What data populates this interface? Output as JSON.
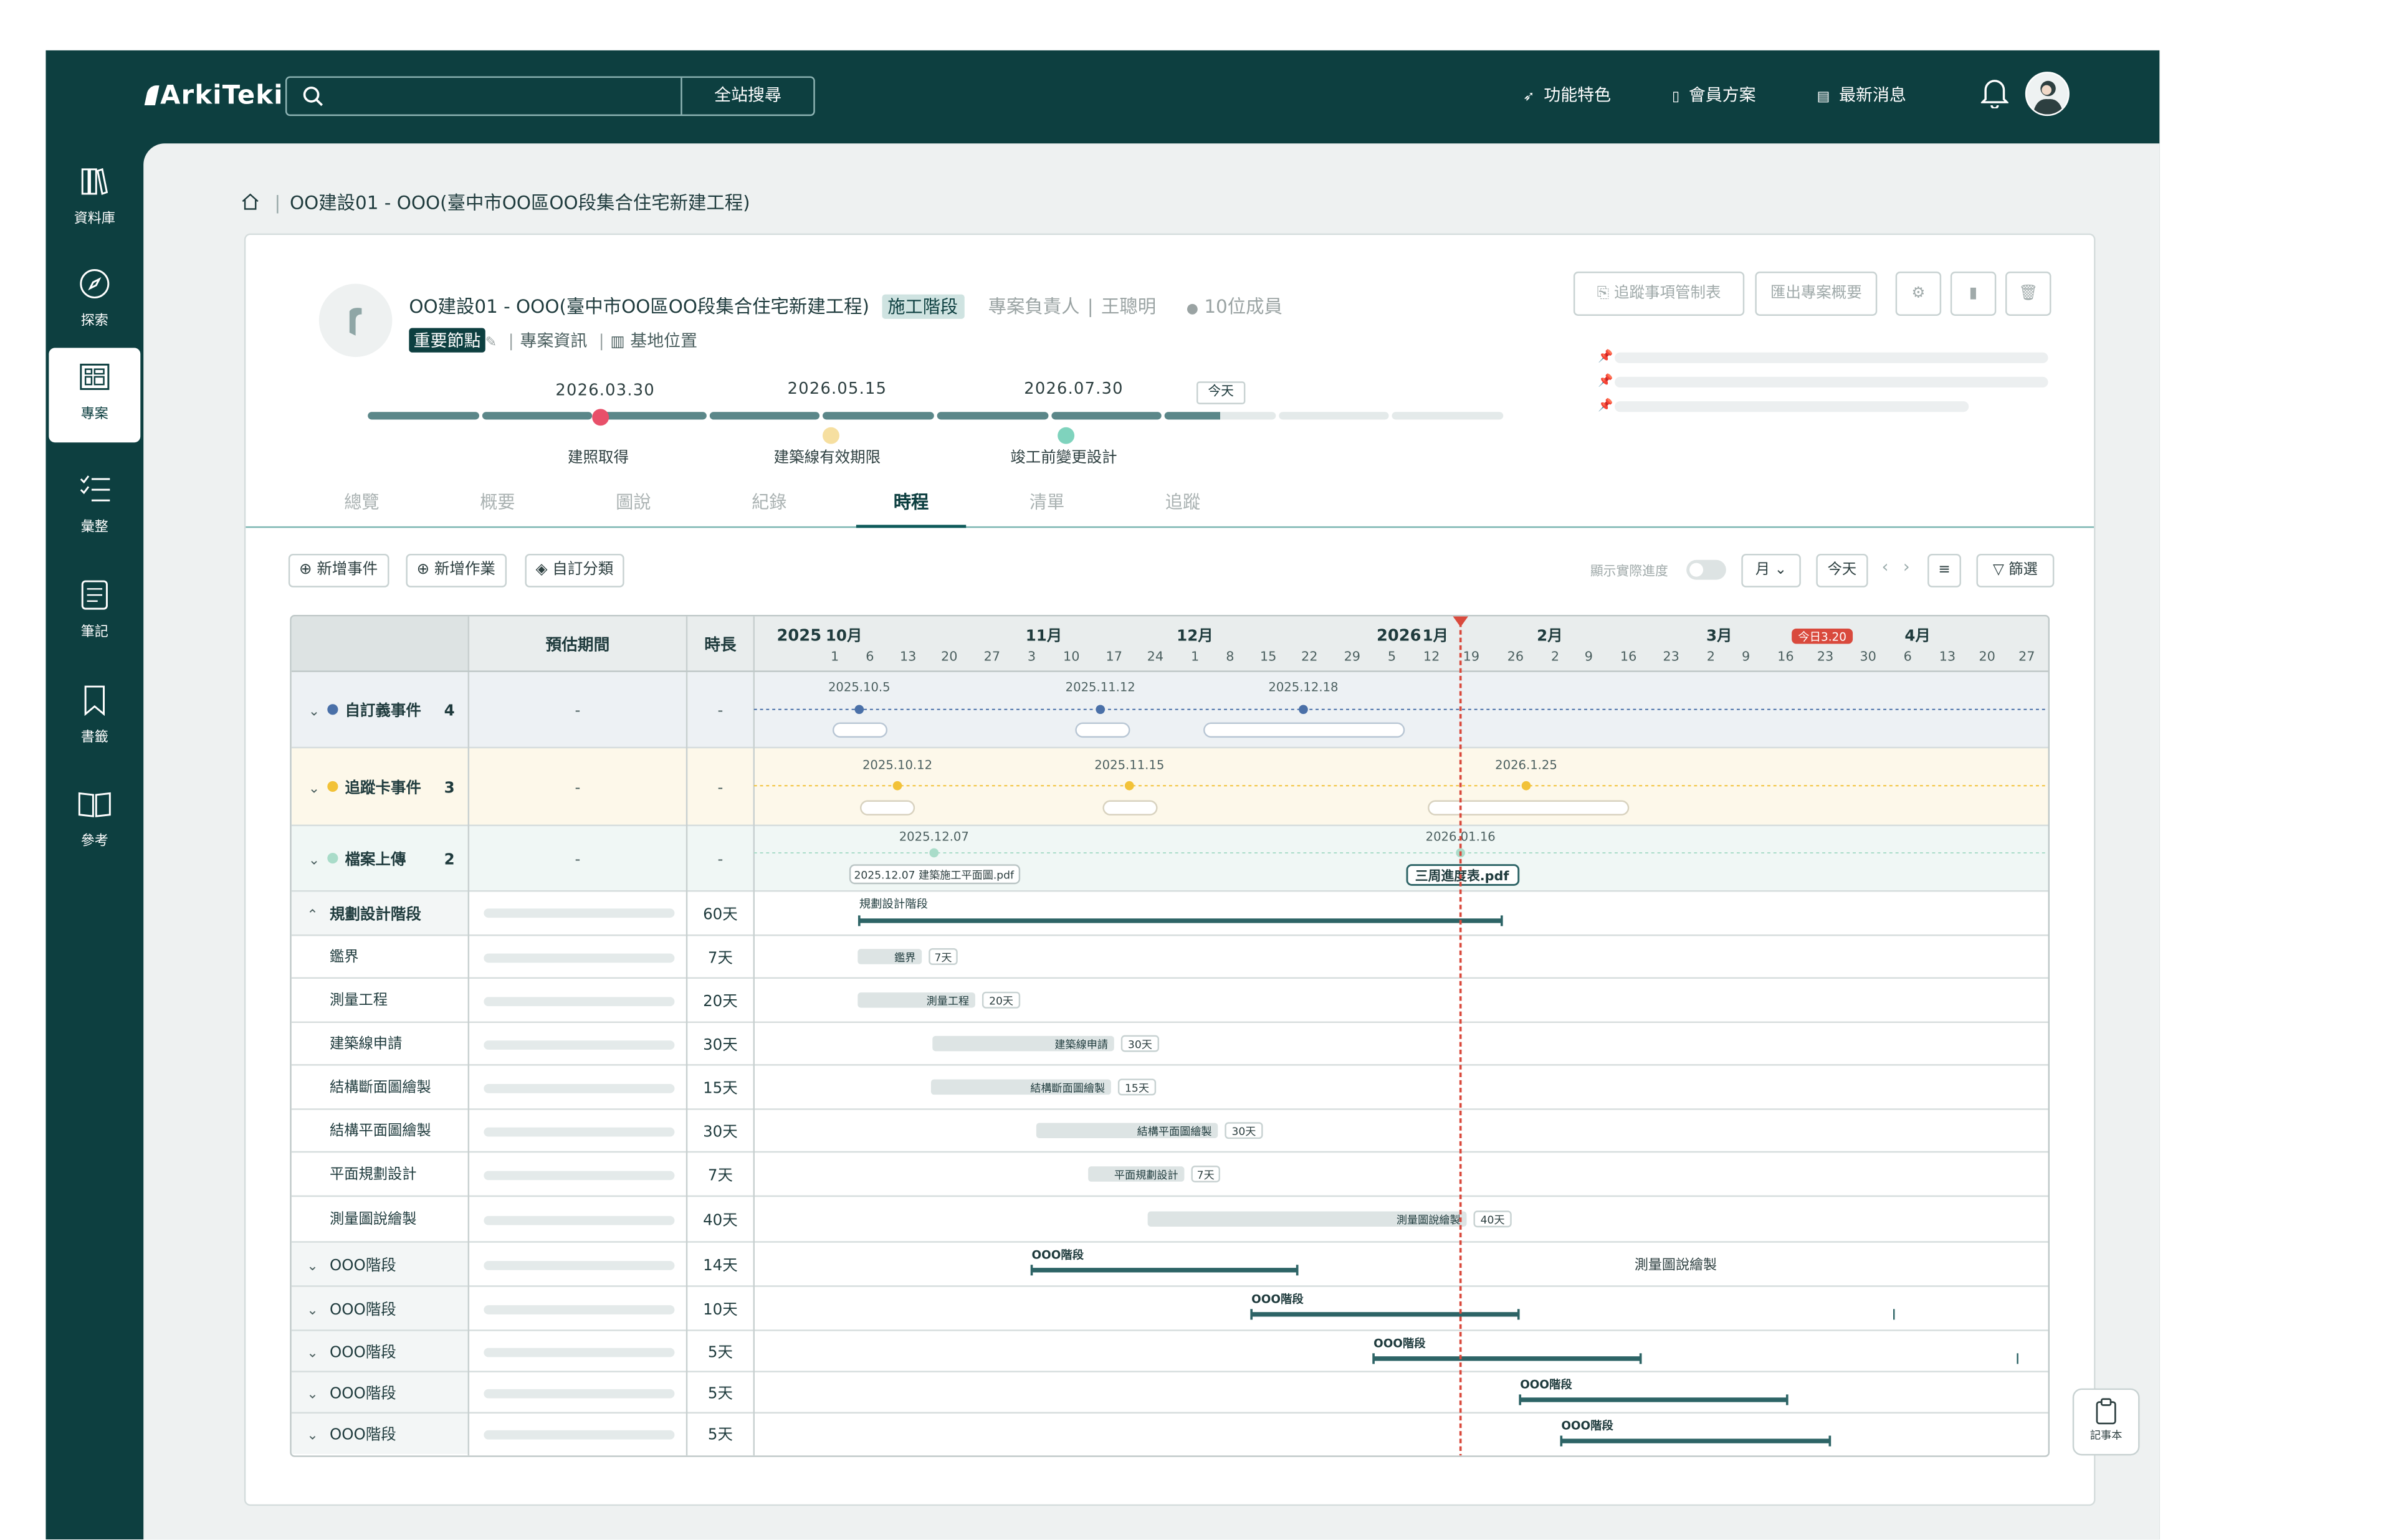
{
  "app": {
    "logo": "ArkiTeki"
  },
  "topbar": {
    "search_placeholder": "",
    "search_button": "全站搜尋",
    "nav": [
      "功能特色",
      "會員方案",
      "最新消息"
    ]
  },
  "sidebar": {
    "items": [
      {
        "label": "資料庫",
        "icon": "books-icon"
      },
      {
        "label": "探索",
        "icon": "compass-icon"
      },
      {
        "label": "專案",
        "icon": "project-icon",
        "active": true
      },
      {
        "label": "彙整",
        "icon": "checklist-icon"
      },
      {
        "label": "筆記",
        "icon": "note-icon"
      },
      {
        "label": "書籤",
        "icon": "bookmark-icon"
      },
      {
        "label": "參考",
        "icon": "book-open-icon"
      }
    ]
  },
  "breadcrumb": {
    "project": "OO建設01 - OOO(臺中市OO區OO段集合住宅新建工程)"
  },
  "project": {
    "title": "OO建設01 - OOO(臺中市OO區OO段集合住宅新建工程)",
    "stage_tag": "施工階段",
    "owner_label": "專案負責人",
    "owner": "王聰明",
    "members": "10位成員",
    "important_tag": "重要節點",
    "links": [
      "專案資訊",
      "基地位置"
    ],
    "buttons": {
      "tracking": "追蹤事項管制表",
      "export": "匯出專案概要"
    }
  },
  "milestones": {
    "today_label": "今天",
    "progress_fraction": 0.75,
    "items": [
      {
        "date": "2026.03.30",
        "label": "建照取得",
        "color": "#e8506a"
      },
      {
        "date": "2026.05.15",
        "label": "建築線有效期限",
        "color": "#f6dfa0"
      },
      {
        "date": "2026.07.30",
        "label": "竣工前變更設計",
        "color": "#7fd3bd"
      }
    ]
  },
  "tabs": [
    "總覽",
    "概要",
    "圖說",
    "紀錄",
    "時程",
    "清單",
    "追蹤"
  ],
  "active_tab": "時程",
  "toolbar": {
    "add_event": "新增事件",
    "add_task": "新增作業",
    "custom_category": "自訂分類",
    "show_progress": "顯示實際進度",
    "view_mode": "月",
    "today": "今天",
    "filter": "篩選"
  },
  "gantt": {
    "col_estimated": "預估期間",
    "col_duration": "時長",
    "year_start": "2025",
    "year_next": "2026",
    "months": [
      "10月",
      "11月",
      "12月",
      "1月",
      "2月",
      "3月",
      "4月"
    ],
    "days": [
      "1",
      "6",
      "13",
      "20",
      "27",
      "3",
      "10",
      "17",
      "24",
      "1",
      "8",
      "15",
      "22",
      "29",
      "5",
      "12",
      "19",
      "26",
      "2",
      "9",
      "16",
      "23",
      "2",
      "9",
      "16",
      "23",
      "30",
      "6",
      "13",
      "20",
      "27"
    ],
    "today_badge": "今日3.20",
    "event_rows": [
      {
        "name": "自訂義事件",
        "count": "4",
        "dot": "#4a70a8",
        "est": "-",
        "dur": "-",
        "dates": [
          "2025.10.5",
          "2025.11.12",
          "2025.12.18"
        ]
      },
      {
        "name": "追蹤卡事件",
        "count": "3",
        "dot": "#f2c238",
        "est": "-",
        "dur": "-",
        "dates": [
          "2025.10.12",
          "2025.11.15",
          "2026.1.25"
        ]
      },
      {
        "name": "檔案上傳",
        "count": "2",
        "dot": "#a9dcc9",
        "est": "-",
        "dur": "-",
        "dates": [
          "2025.12.07",
          "2026.01.16"
        ],
        "files": [
          "2025.12.07 建築施工平面圖.pdf",
          "三周進度表.pdf"
        ]
      }
    ],
    "phase": {
      "name": "規劃設計階段",
      "dur": "60天",
      "bar_label": "規劃設計階段"
    },
    "tasks": [
      {
        "name": "鑑界",
        "dur": "7天"
      },
      {
        "name": "測量工程",
        "dur": "20天"
      },
      {
        "name": "建築線申請",
        "dur": "30天"
      },
      {
        "name": "結構斷面圖繪製",
        "dur": "15天"
      },
      {
        "name": "結構平面圖繪製",
        "dur": "30天"
      },
      {
        "name": "平面規劃設計",
        "dur": "7天"
      },
      {
        "name": "測量圖說繪製",
        "dur": "40天"
      }
    ],
    "stages": [
      {
        "name": "OOO階段",
        "dur": "14天"
      },
      {
        "name": "OOO階段",
        "dur": "10天"
      },
      {
        "name": "OOO階段",
        "dur": "5天"
      },
      {
        "name": "OOO階段",
        "dur": "5天"
      },
      {
        "name": "OOO階段",
        "dur": "5天"
      }
    ],
    "floating_label": "測量圖說繪製"
  },
  "notebook": "記事本",
  "colors": {
    "primary": "#0d3f40",
    "accent_red": "#d94a3d",
    "bar": "#2d6466"
  }
}
